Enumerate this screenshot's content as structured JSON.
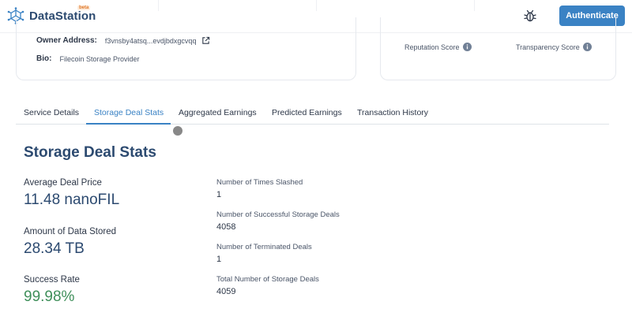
{
  "header": {
    "brand": "DataStation",
    "beta_badge": "beta",
    "auth_button": "Authenticate"
  },
  "profile": {
    "owner_label": "Owner Address:",
    "owner_value": "f3vnsby4atsq...evdjbdxgcvqq",
    "bio_label": "Bio:",
    "bio_value": "Filecoin Storage Provider",
    "reputation_label": "Reputation Score",
    "transparency_label": "Transparency Score"
  },
  "tabs": [
    {
      "label": "Service Details",
      "active": false
    },
    {
      "label": "Storage Deal Stats",
      "active": true
    },
    {
      "label": "Aggregated Earnings",
      "active": false
    },
    {
      "label": "Predicted Earnings",
      "active": false
    },
    {
      "label": "Transaction History",
      "active": false
    }
  ],
  "stats": {
    "title": "Storage Deal Stats",
    "main": [
      {
        "label": "Average Deal Price",
        "value": "11.48 nanoFIL"
      },
      {
        "label": "Amount of Data Stored",
        "value": "28.34 TB"
      },
      {
        "label": "Success Rate",
        "value": "99.98%"
      }
    ],
    "secondary": [
      {
        "label": "Number of Times Slashed",
        "value": "1"
      },
      {
        "label": "Number of Successful Storage Deals",
        "value": "4058"
      },
      {
        "label": "Number of Terminated Deals",
        "value": "1"
      },
      {
        "label": "Total Number of Storage Deals",
        "value": "4059"
      }
    ]
  },
  "colors": {
    "accent": "#3a82c4",
    "brand_text": "#2c4a70",
    "success": "#3f8f5a",
    "beta": "#e07a2e"
  }
}
